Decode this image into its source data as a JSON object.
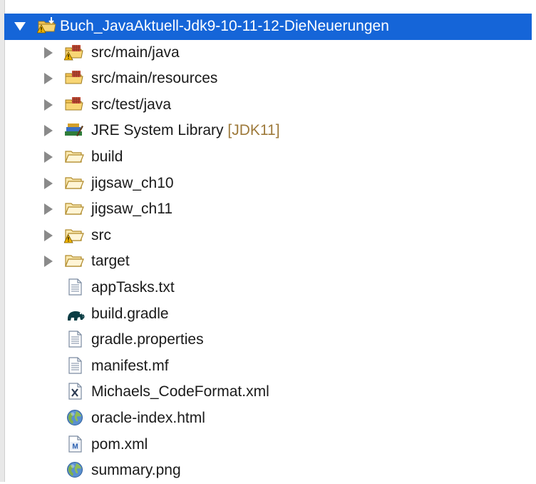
{
  "project": {
    "name": "Buch_JavaAktuell-Jdk9-10-11-12-DieNeuerungen",
    "icon": "project-folder-warning-icon",
    "expanded": true
  },
  "items": [
    {
      "label": "src/main/java",
      "suffix": "",
      "icon": "source-package-folder-warning-icon",
      "expandable": true
    },
    {
      "label": "src/main/resources",
      "suffix": "",
      "icon": "source-package-folder-icon",
      "expandable": true
    },
    {
      "label": "src/test/java",
      "suffix": "",
      "icon": "source-package-folder-icon",
      "expandable": true
    },
    {
      "label": "JRE System Library",
      "suffix": "[JDK11]",
      "icon": "library-books-icon",
      "expandable": true
    },
    {
      "label": "build",
      "suffix": "",
      "icon": "folder-icon",
      "expandable": true
    },
    {
      "label": "jigsaw_ch10",
      "suffix": "",
      "icon": "folder-icon",
      "expandable": true
    },
    {
      "label": "jigsaw_ch11",
      "suffix": "",
      "icon": "folder-icon",
      "expandable": true
    },
    {
      "label": "src",
      "suffix": "",
      "icon": "folder-warning-icon",
      "expandable": true
    },
    {
      "label": "target",
      "suffix": "",
      "icon": "folder-icon",
      "expandable": true
    },
    {
      "label": "appTasks.txt",
      "suffix": "",
      "icon": "text-file-icon",
      "expandable": false
    },
    {
      "label": "build.gradle",
      "suffix": "",
      "icon": "gradle-elephant-icon",
      "expandable": false
    },
    {
      "label": "gradle.properties",
      "suffix": "",
      "icon": "text-file-icon",
      "expandable": false
    },
    {
      "label": "manifest.mf",
      "suffix": "",
      "icon": "text-file-icon",
      "expandable": false
    },
    {
      "label": "Michaels_CodeFormat.xml",
      "suffix": "",
      "icon": "xml-file-icon",
      "expandable": false
    },
    {
      "label": "oracle-index.html",
      "suffix": "",
      "icon": "globe-icon",
      "expandable": false
    },
    {
      "label": "pom.xml",
      "suffix": "",
      "icon": "maven-pom-icon",
      "expandable": false
    },
    {
      "label": "summary.png",
      "suffix": "",
      "icon": "globe-icon",
      "expandable": false
    }
  ],
  "colors": {
    "selection": "#1565d8",
    "folder": "#f3c354",
    "warning": "#e8a600",
    "suffix": "#9e7a3b"
  }
}
